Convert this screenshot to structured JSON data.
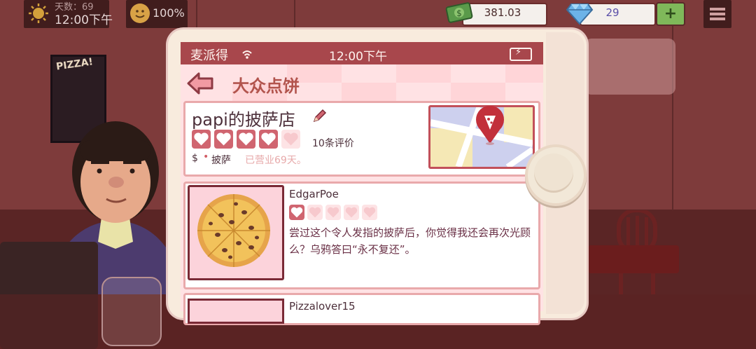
{
  "hud": {
    "weather_label": "天数：69",
    "time": "12:00下午",
    "mood": "100%",
    "money": "381.03",
    "gems": "29",
    "plus_label": "+",
    "icons": [
      "sun-icon",
      "happy-face-icon",
      "cash-icon",
      "diamond-icon",
      "menu-icon"
    ]
  },
  "scene": {
    "poster_text": "PIZZA!"
  },
  "phone": {
    "carrier": "麦派得",
    "clock": "12:00下午",
    "battery_icon": "battery-charging-icon"
  },
  "app": {
    "title": "大众点饼",
    "shop": {
      "name": "papi的披萨店",
      "rating": 4,
      "rating_max": 5,
      "review_count": "10条评价",
      "price": "$",
      "separator": "•",
      "cuisine": "披萨",
      "open_days": "已营业69天。"
    },
    "reviews": [
      {
        "author": "EdgarPoe",
        "rating": 1,
        "rating_max": 5,
        "text": "尝过这个令人发指的披萨后，你觉得我还会再次光顾么？乌鸦答曰“永不复还”。"
      },
      {
        "author": "Pizzalover15"
      }
    ]
  },
  "colors": {
    "accent": "#a8474c",
    "heart_filled": "#d06570",
    "heart_empty": "#f7c9cd",
    "title": "#b2544d"
  }
}
